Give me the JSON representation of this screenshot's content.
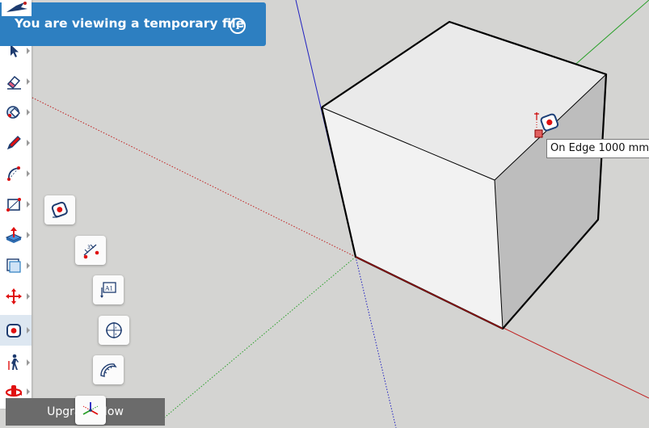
{
  "banner": {
    "text": "You are viewing a temporary file",
    "info_icon": "info-icon",
    "color": "#2d7fc1"
  },
  "toolbar": {
    "tools": [
      {
        "name": "select-tool",
        "icon": "arrow-cursor-icon"
      },
      {
        "name": "eraser-tool",
        "icon": "eraser-icon"
      },
      {
        "name": "paint-bucket-tool",
        "icon": "paint-bucket-icon"
      },
      {
        "name": "pencil-tool",
        "icon": "pencil-icon"
      },
      {
        "name": "arc-tool",
        "icon": "arc-icon"
      },
      {
        "name": "rectangle-tool",
        "icon": "rectangle-icon"
      },
      {
        "name": "push-pull-tool",
        "icon": "push-pull-icon"
      },
      {
        "name": "offset-tool",
        "icon": "offset-icon"
      },
      {
        "name": "move-tool",
        "icon": "move-icon"
      },
      {
        "name": "tape-measure-tool",
        "icon": "tape-measure-icon",
        "active": true
      },
      {
        "name": "walk-tool",
        "icon": "walk-icon"
      },
      {
        "name": "orbit-tool",
        "icon": "orbit-icon"
      }
    ]
  },
  "flyout": {
    "items": [
      {
        "name": "tape-measure-tool",
        "icon": "tape-measure-icon"
      },
      {
        "name": "dimension-tool",
        "icon": "dimension-icon"
      },
      {
        "name": "text-tool",
        "icon": "text-label-icon",
        "label": "A1"
      },
      {
        "name": "protractor-tool",
        "icon": "protractor-icon"
      },
      {
        "name": "3d-text-tool",
        "icon": "3d-text-icon"
      },
      {
        "name": "axes-tool",
        "icon": "axes-icon"
      }
    ]
  },
  "upgrade": {
    "label": "Upgrade Now"
  },
  "tooltip": {
    "text": "On Edge 1000 mm"
  },
  "colors": {
    "background": "#d4d4d2",
    "axis_red": "#c02020",
    "axis_green": "#2aa02a",
    "axis_blue": "#2020c0",
    "cube_top": "#eaeaea",
    "cube_left": "#f2f2f2",
    "cube_right": "#bdbdbd"
  }
}
